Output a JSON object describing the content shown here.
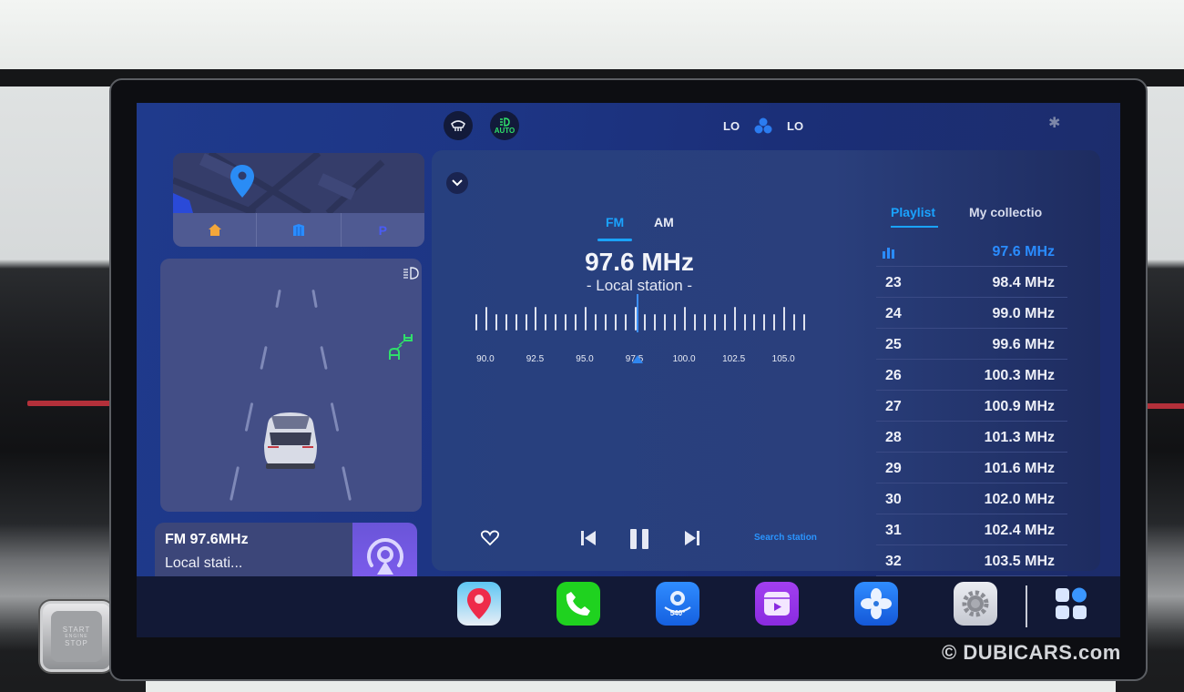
{
  "status_bar": {
    "defrost_icon": "rear-defrost-icon",
    "auto_headlight_label": "AUTO",
    "temp_left": "LO",
    "fan_icon": "fan-icon",
    "temp_right": "LO",
    "bluetooth_icon": "bluetooth-icon",
    "colors": {
      "auto_green": "#2fe06a",
      "fan_blue": "#2b7cf0"
    }
  },
  "map_widget": {
    "pin_icon": "location-pin-icon",
    "quick_actions": [
      {
        "name": "home",
        "icon": "home-icon",
        "color": "#f3a63a"
      },
      {
        "name": "company",
        "icon": "building-icon",
        "color": "#2a8cff"
      },
      {
        "name": "parking",
        "icon": "parking-icon",
        "color": "#4a5cf5"
      }
    ]
  },
  "adas_widget": {
    "auto_headlight_icon": "auto-high-beam-icon",
    "following_distance_icon": "car-following-distance-icon"
  },
  "media_widget": {
    "title": "FM 97.6MHz",
    "subtitle": "Local stati...",
    "art_icon": "radio-broadcast-icon",
    "controls": [
      "previous",
      "pause",
      "next"
    ]
  },
  "radio": {
    "bands": [
      "FM",
      "AM"
    ],
    "selected_band": "FM",
    "frequency": "97.6 MHz",
    "station_label": "- Local station -",
    "tuner": {
      "min": 89.5,
      "max": 106.0,
      "step": 0.5,
      "major_every": 2.5,
      "labels": [
        "90.0",
        "92.5",
        "95.0",
        "97.5",
        "100.0",
        "102.5",
        "105.0"
      ],
      "current": 97.6
    },
    "controls": {
      "favorite": "heart-icon",
      "previous": "skip-previous-icon",
      "pause": "pause-icon",
      "next": "skip-next-icon"
    },
    "search_label": "Search station",
    "accent": "#1aa3ff"
  },
  "playlist": {
    "tabs": [
      "Playlist",
      "My collectio"
    ],
    "selected_tab": "Playlist",
    "items": [
      {
        "num": "",
        "freq": "97.6 MHz",
        "active": true
      },
      {
        "num": "23",
        "freq": "98.4 MHz"
      },
      {
        "num": "24",
        "freq": "99.0 MHz"
      },
      {
        "num": "25",
        "freq": "99.6 MHz"
      },
      {
        "num": "26",
        "freq": "100.3 MHz"
      },
      {
        "num": "27",
        "freq": "100.9 MHz"
      },
      {
        "num": "28",
        "freq": "101.3 MHz"
      },
      {
        "num": "29",
        "freq": "101.6 MHz"
      },
      {
        "num": "30",
        "freq": "102.0 MHz"
      },
      {
        "num": "31",
        "freq": "102.4 MHz"
      },
      {
        "num": "32",
        "freq": "103.5 MHz"
      }
    ]
  },
  "dock": {
    "apps": [
      {
        "name": "navigation",
        "icon": "map-pin-icon"
      },
      {
        "name": "phone",
        "icon": "phone-icon"
      },
      {
        "name": "540-camera",
        "icon": "camera-540-icon",
        "badge": "540°"
      },
      {
        "name": "video",
        "icon": "video-player-icon"
      },
      {
        "name": "climate",
        "icon": "fan-icon"
      },
      {
        "name": "settings",
        "icon": "gear-icon"
      },
      {
        "name": "all-apps",
        "icon": "app-grid-icon"
      }
    ]
  },
  "hardware": {
    "start_button": [
      "START",
      "ENGINE",
      "STOP"
    ]
  },
  "watermark": "© DUBICARS.com"
}
